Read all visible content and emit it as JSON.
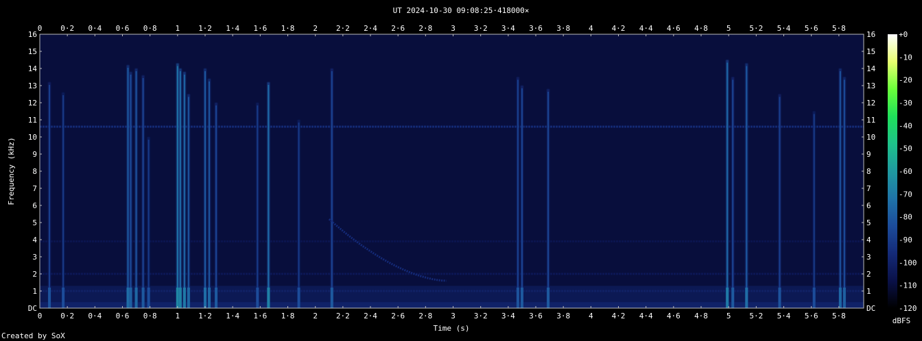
{
  "chart_data": {
    "type": "heatmap",
    "title": "UT 2024-10-30 09:08:25·418000×",
    "xlabel": "Time (s)",
    "ylabel": "Frequency (kHz)",
    "xlim": [
      0,
      5.98
    ],
    "ylim": [
      0,
      16
    ],
    "x_ticks": [
      {
        "value": 0,
        "label": "0"
      },
      {
        "value": 0.2,
        "label": "0·2"
      },
      {
        "value": 0.4,
        "label": "0·4"
      },
      {
        "value": 0.6,
        "label": "0·6"
      },
      {
        "value": 0.8,
        "label": "0·8"
      },
      {
        "value": 1,
        "label": "1"
      },
      {
        "value": 1.2,
        "label": "1·2"
      },
      {
        "value": 1.4,
        "label": "1·4"
      },
      {
        "value": 1.6,
        "label": "1·6"
      },
      {
        "value": 1.8,
        "label": "1·8"
      },
      {
        "value": 2,
        "label": "2"
      },
      {
        "value": 2.2,
        "label": "2·2"
      },
      {
        "value": 2.4,
        "label": "2·4"
      },
      {
        "value": 2.6,
        "label": "2·6"
      },
      {
        "value": 2.8,
        "label": "2·8"
      },
      {
        "value": 3,
        "label": "3"
      },
      {
        "value": 3.2,
        "label": "3·2"
      },
      {
        "value": 3.4,
        "label": "3·4"
      },
      {
        "value": 3.6,
        "label": "3·6"
      },
      {
        "value": 3.8,
        "label": "3·8"
      },
      {
        "value": 4,
        "label": "4"
      },
      {
        "value": 4.2,
        "label": "4·2"
      },
      {
        "value": 4.4,
        "label": "4·4"
      },
      {
        "value": 4.6,
        "label": "4·6"
      },
      {
        "value": 4.8,
        "label": "4·8"
      },
      {
        "value": 5,
        "label": "5"
      },
      {
        "value": 5.2,
        "label": "5·2"
      },
      {
        "value": 5.4,
        "label": "5·4"
      },
      {
        "value": 5.6,
        "label": "5·6"
      },
      {
        "value": 5.8,
        "label": "5·8"
      }
    ],
    "y_ticks": [
      {
        "value": 0,
        "label": "DC"
      },
      {
        "value": 1,
        "label": "1"
      },
      {
        "value": 2,
        "label": "2"
      },
      {
        "value": 3,
        "label": "3"
      },
      {
        "value": 4,
        "label": "4"
      },
      {
        "value": 5,
        "label": "5"
      },
      {
        "value": 6,
        "label": "6"
      },
      {
        "value": 7,
        "label": "7"
      },
      {
        "value": 8,
        "label": "8"
      },
      {
        "value": 9,
        "label": "9"
      },
      {
        "value": 10,
        "label": "10"
      },
      {
        "value": 11,
        "label": "11"
      },
      {
        "value": 12,
        "label": "12"
      },
      {
        "value": 13,
        "label": "13"
      },
      {
        "value": 14,
        "label": "14"
      },
      {
        "value": 15,
        "label": "15"
      },
      {
        "value": 16,
        "label": "16"
      }
    ],
    "colorbar": {
      "unit_label": "dBFS",
      "range": [
        -120,
        0
      ],
      "ticks": [
        {
          "value": 0,
          "label": "+0"
        },
        {
          "value": -10,
          "label": "-10"
        },
        {
          "value": -20,
          "label": "-20"
        },
        {
          "value": -30,
          "label": "-30"
        },
        {
          "value": -40,
          "label": "-40"
        },
        {
          "value": -50,
          "label": "-50"
        },
        {
          "value": -60,
          "label": "-60"
        },
        {
          "value": -70,
          "label": "-70"
        },
        {
          "value": -80,
          "label": "-80"
        },
        {
          "value": -90,
          "label": "-90"
        },
        {
          "value": -100,
          "label": "-100"
        },
        {
          "value": -110,
          "label": "-110"
        },
        {
          "value": -120,
          "label": "-120"
        }
      ],
      "colors": [
        "#ffffff",
        "#e8ff70",
        "#6aff3a",
        "#1fe05a",
        "#1ec28a",
        "#1f9aa0",
        "#1f74a8",
        "#1c4c9a",
        "#142a78",
        "#0a1148",
        "#000000"
      ]
    },
    "background_level_dbfs": -110,
    "hum_lines": [
      {
        "freq_khz": 10.6,
        "level_dbfs": -95
      },
      {
        "freq_khz": 1.0,
        "level_dbfs": -100
      },
      {
        "freq_khz": 2.0,
        "level_dbfs": -104
      },
      {
        "freq_khz": 3.9,
        "level_dbfs": -106
      }
    ],
    "impulses": [
      {
        "t": 0.07,
        "fmax": 13.2,
        "level_dbfs": -88
      },
      {
        "t": 0.17,
        "fmax": 12.6,
        "level_dbfs": -90
      },
      {
        "t": 0.64,
        "fmax": 14.2,
        "level_dbfs": -80
      },
      {
        "t": 0.66,
        "fmax": 13.8,
        "level_dbfs": -84
      },
      {
        "t": 0.7,
        "fmax": 14.0,
        "level_dbfs": -82
      },
      {
        "t": 0.75,
        "fmax": 13.6,
        "level_dbfs": -86
      },
      {
        "t": 0.79,
        "fmax": 10.0,
        "level_dbfs": -90
      },
      {
        "t": 1.0,
        "fmax": 14.3,
        "level_dbfs": -72
      },
      {
        "t": 1.02,
        "fmax": 14.0,
        "level_dbfs": -74
      },
      {
        "t": 1.05,
        "fmax": 13.8,
        "level_dbfs": -76
      },
      {
        "t": 1.08,
        "fmax": 12.5,
        "level_dbfs": -82
      },
      {
        "t": 1.2,
        "fmax": 14.0,
        "level_dbfs": -80
      },
      {
        "t": 1.23,
        "fmax": 13.4,
        "level_dbfs": -82
      },
      {
        "t": 1.28,
        "fmax": 12.0,
        "level_dbfs": -86
      },
      {
        "t": 1.58,
        "fmax": 12.0,
        "level_dbfs": -90
      },
      {
        "t": 1.66,
        "fmax": 13.2,
        "level_dbfs": -74
      },
      {
        "t": 1.88,
        "fmax": 11.0,
        "level_dbfs": -90
      },
      {
        "t": 2.12,
        "fmax": 14.0,
        "level_dbfs": -86
      },
      {
        "t": 3.47,
        "fmax": 13.5,
        "level_dbfs": -88
      },
      {
        "t": 3.5,
        "fmax": 13.0,
        "level_dbfs": -86
      },
      {
        "t": 3.69,
        "fmax": 12.8,
        "level_dbfs": -86
      },
      {
        "t": 4.99,
        "fmax": 14.5,
        "level_dbfs": -76
      },
      {
        "t": 5.03,
        "fmax": 13.5,
        "level_dbfs": -86
      },
      {
        "t": 5.13,
        "fmax": 14.3,
        "level_dbfs": -80
      },
      {
        "t": 5.37,
        "fmax": 12.5,
        "level_dbfs": -88
      },
      {
        "t": 5.62,
        "fmax": 11.5,
        "level_dbfs": -90
      },
      {
        "t": 5.81,
        "fmax": 14.0,
        "level_dbfs": -82
      },
      {
        "t": 5.84,
        "fmax": 13.5,
        "level_dbfs": -84
      }
    ],
    "sweep": {
      "t_start": 2.1,
      "t_end": 2.95,
      "f_start_khz": 5.2,
      "f_end_khz": 1.6,
      "level_dbfs": -96
    }
  },
  "footer": "Created by SoX"
}
